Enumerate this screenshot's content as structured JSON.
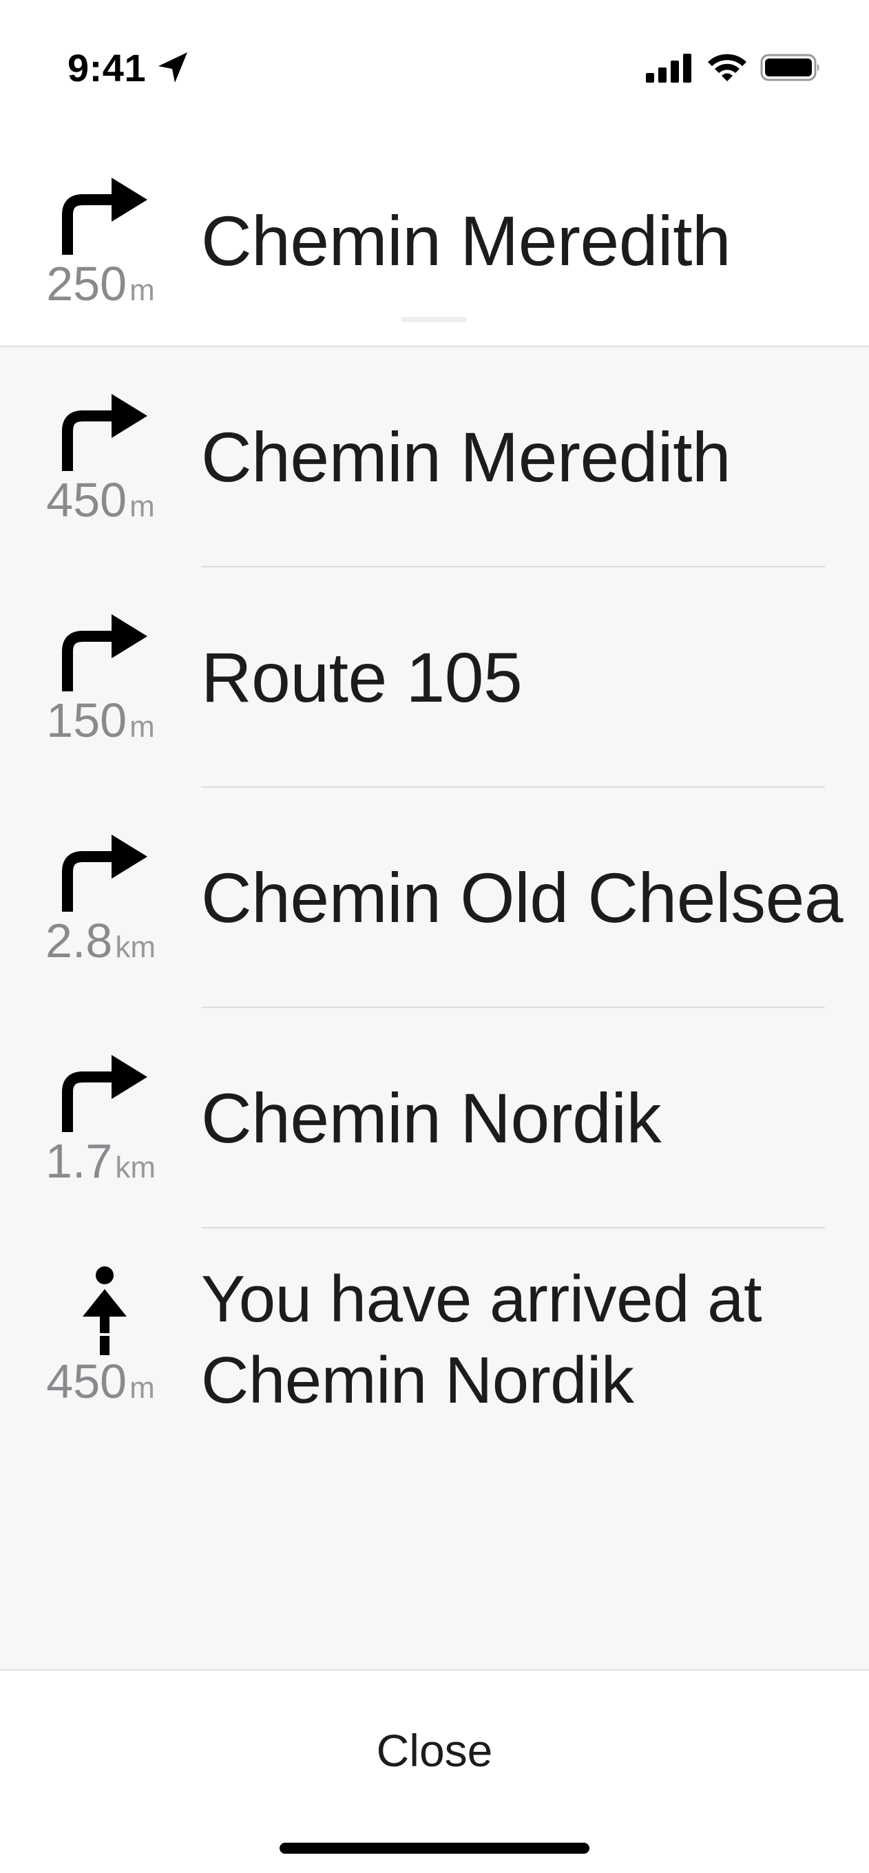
{
  "status_bar": {
    "time": "9:41",
    "icons": [
      "location-arrow-icon",
      "cellular-signal-icon",
      "wifi-icon",
      "battery-icon"
    ]
  },
  "current_step": {
    "icon": "turn-right-icon",
    "distance_value": "250",
    "distance_unit": "m",
    "instruction": "Chemin Meredith"
  },
  "steps": [
    {
      "icon": "turn-right-icon",
      "distance_value": "450",
      "distance_unit": "m",
      "instruction": "Chemin Meredith"
    },
    {
      "icon": "turn-right-icon",
      "distance_value": "150",
      "distance_unit": "m",
      "instruction": "Route 105"
    },
    {
      "icon": "turn-right-icon",
      "distance_value": "2.8",
      "distance_unit": "km",
      "instruction": "Chemin Old Chelsea"
    },
    {
      "icon": "turn-right-icon",
      "distance_value": "1.7",
      "distance_unit": "km",
      "instruction": "Chemin Nordik"
    },
    {
      "icon": "arrive-icon",
      "distance_value": "450",
      "distance_unit": "m",
      "instruction": "You have arrived at Chemin Nordik"
    }
  ],
  "footer": {
    "close_label": "Close"
  }
}
